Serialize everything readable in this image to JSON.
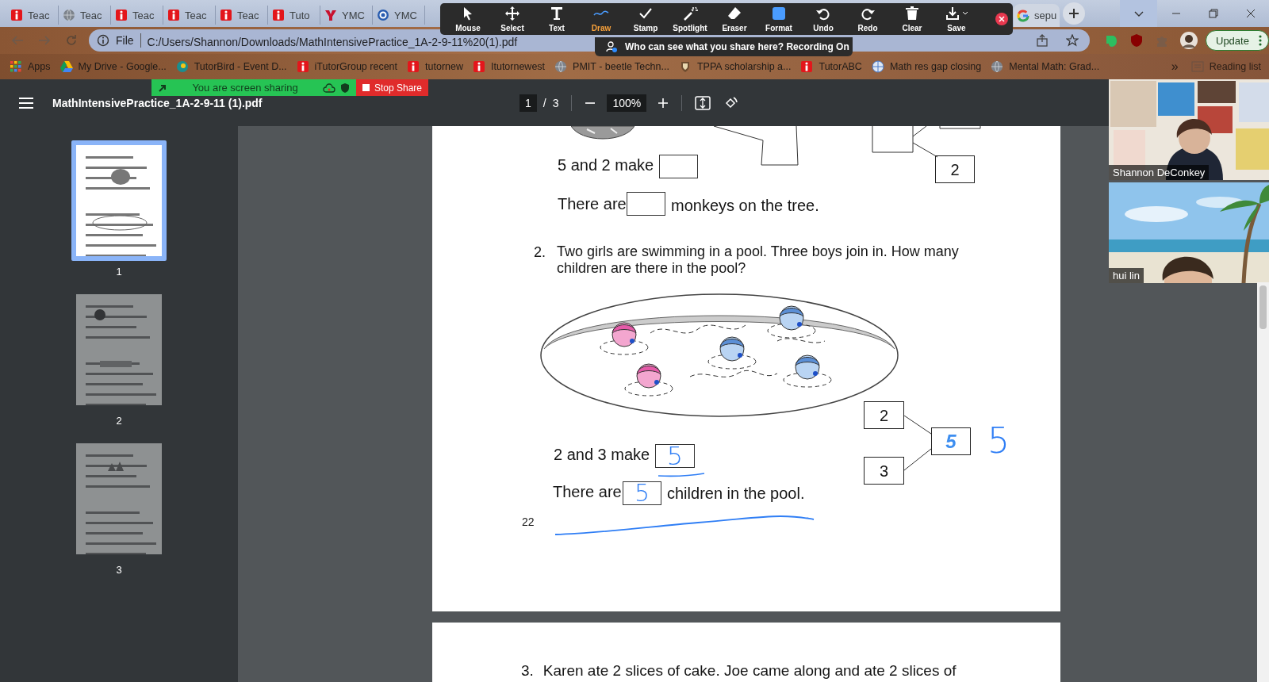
{
  "browser_tabs": [
    {
      "title": "Teac",
      "kind": "red-i",
      "selected": false
    },
    {
      "title": "Teac",
      "kind": "globe",
      "selected": false
    },
    {
      "title": "Teac",
      "kind": "red-i",
      "selected": false
    },
    {
      "title": "Teac",
      "kind": "red-i",
      "selected": false
    },
    {
      "title": "Teac",
      "kind": "red-i",
      "selected": false
    },
    {
      "title": "Tuto",
      "kind": "red-i",
      "selected": false
    },
    {
      "title": "YMC",
      "kind": "red-y",
      "selected": false
    },
    {
      "title": "YMC",
      "kind": "blue-g",
      "selected": false
    }
  ],
  "browser_tabs_right": [
    {
      "title": "sepu",
      "kind": "google",
      "selected": false
    }
  ],
  "address_bar": {
    "scheme": "File",
    "url": "C:/Users/Shannon/Downloads/MathIntensivePractice_1A-2-9-11%20(1).pdf"
  },
  "update_button": "Update",
  "bookmarks": [
    {
      "label": "Apps",
      "kind": "apps"
    },
    {
      "label": "My Drive - Google...",
      "kind": "drive"
    },
    {
      "label": "TutorBird - Event D...",
      "kind": "bird"
    },
    {
      "label": "iTutorGroup recent",
      "kind": "red-i"
    },
    {
      "label": "tutornew",
      "kind": "red-i"
    },
    {
      "label": "Itutornewest",
      "kind": "red-i"
    },
    {
      "label": "PMIT - beetle Techn...",
      "kind": "globe"
    },
    {
      "label": "TPPA scholarship a...",
      "kind": "crest"
    },
    {
      "label": "TutorABC",
      "kind": "red-i"
    },
    {
      "label": "Math res gap closing",
      "kind": "web"
    },
    {
      "label": "Mental Math: Grad...",
      "kind": "globe"
    }
  ],
  "bookmarks_more": "»",
  "reading_list": "Reading list",
  "zoom_toolbar": {
    "tools": [
      {
        "label": "Mouse",
        "kind": "mouse",
        "selected": false
      },
      {
        "label": "Select",
        "kind": "select",
        "selected": false
      },
      {
        "label": "Text",
        "kind": "text",
        "selected": false
      },
      {
        "label": "Draw",
        "kind": "draw",
        "selected": true
      },
      {
        "label": "Stamp",
        "kind": "stamp",
        "selected": false
      },
      {
        "label": "Spotlight",
        "kind": "spotlight",
        "selected": false
      },
      {
        "label": "Eraser",
        "kind": "eraser",
        "selected": false
      },
      {
        "label": "Format",
        "kind": "format",
        "selected": false
      },
      {
        "label": "Undo",
        "kind": "undo",
        "selected": false
      },
      {
        "label": "Redo",
        "kind": "redo",
        "selected": false
      },
      {
        "label": "Clear",
        "kind": "clear",
        "selected": false
      },
      {
        "label": "Save",
        "kind": "save",
        "selected": false
      }
    ]
  },
  "share_notice": "Who can see what you share here? Recording On",
  "share_banner": {
    "status": "You are screen sharing",
    "stop": "Stop Share"
  },
  "pdf_toolbar": {
    "title": "MathIntensivePractice_1A-2-9-11 (1).pdf",
    "page": "1",
    "separator": "/",
    "page_count": "3",
    "zoom": "100%"
  },
  "thumbnails": [
    {
      "label": "1",
      "selected": true
    },
    {
      "label": "2",
      "selected": false
    },
    {
      "label": "3",
      "selected": false
    }
  ],
  "worksheet": {
    "q1": {
      "make": "5 and 2 make",
      "there_are": "There are",
      "tail": "monkeys on the tree.",
      "bond_part": "2"
    },
    "q2": {
      "number": "2.",
      "question": "Two girls are swimming in a pool. Three boys join in. How many children are there in the pool?",
      "make": "2 and 3 make",
      "make_answer": "5",
      "there_are": "There are",
      "count_answer": "5",
      "tail": "children in the pool.",
      "bond_parts": [
        "2",
        "3"
      ],
      "bond_whole": "5",
      "side_note": "5"
    },
    "page_number": "22"
  },
  "next_page": {
    "number": "3.",
    "text": "Karen ate 2 slices of cake. Joe came along and ate 2 slices of"
  },
  "videos": [
    {
      "name": "Shannon DeConkey"
    },
    {
      "name": "hui lin"
    }
  ]
}
